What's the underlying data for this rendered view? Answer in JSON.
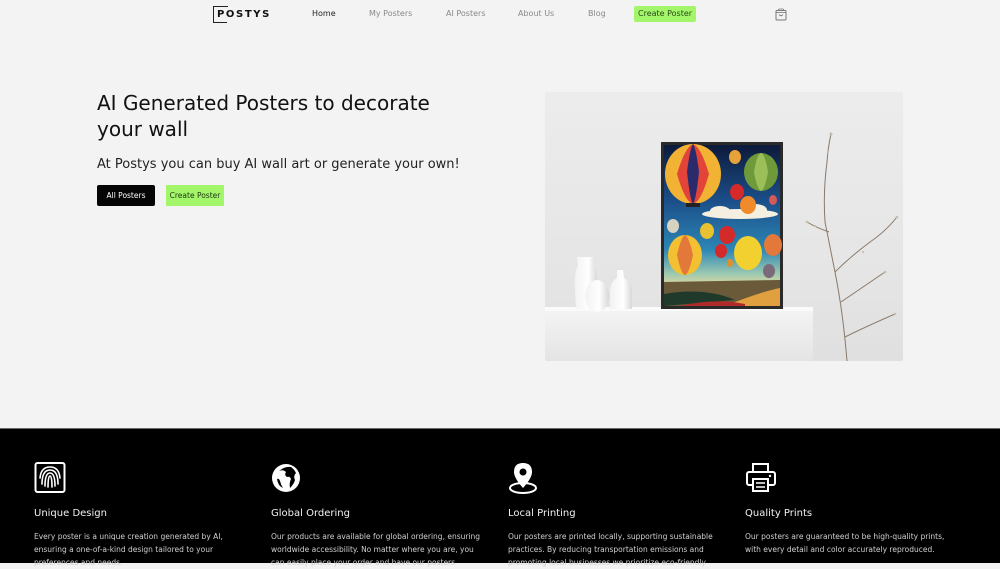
{
  "nav": {
    "logo": "POSTYS",
    "links": [
      {
        "label": "Home",
        "active": true
      },
      {
        "label": "My Posters",
        "active": false
      },
      {
        "label": "AI Posters",
        "active": false
      },
      {
        "label": "About Us",
        "active": false
      },
      {
        "label": "Blog",
        "active": false
      }
    ],
    "cta_label": "Create Poster",
    "cart_icon": "shopping-bag-icon"
  },
  "hero": {
    "title": "AI Generated Posters to decorate your wall",
    "subtitle": "At Postys you can buy AI wall art or generate your own!",
    "primary_button": "All Posters",
    "secondary_button": "Create Poster",
    "image_alt": "Framed hot air balloon poster on a white shelf with vases and a branch"
  },
  "features": [
    {
      "icon": "fingerprint-icon",
      "title": "Unique Design",
      "description": "Every poster is a unique creation generated by AI, ensuring a one-of-a-kind design tailored to your preferences and needs."
    },
    {
      "icon": "globe-icon",
      "title": "Global Ordering",
      "description": "Our products are available for global ordering, ensuring worldwide accessibility. No matter where you are, you can easily place your order and have our posters"
    },
    {
      "icon": "map-pin-icon",
      "title": "Local Printing",
      "description": "Our posters are printed locally, supporting sustainable practices. By reducing transportation emissions and promoting local businesses we prioritize eco-friendly"
    },
    {
      "icon": "printer-icon",
      "title": "Quality Prints",
      "description": "Our posters are guaranteed to be high-quality prints, with every detail and color accurately reproduced."
    }
  ],
  "colors": {
    "accent": "#a3f56a",
    "page_bg": "#f3f3f3",
    "dark_bg": "#000000"
  }
}
